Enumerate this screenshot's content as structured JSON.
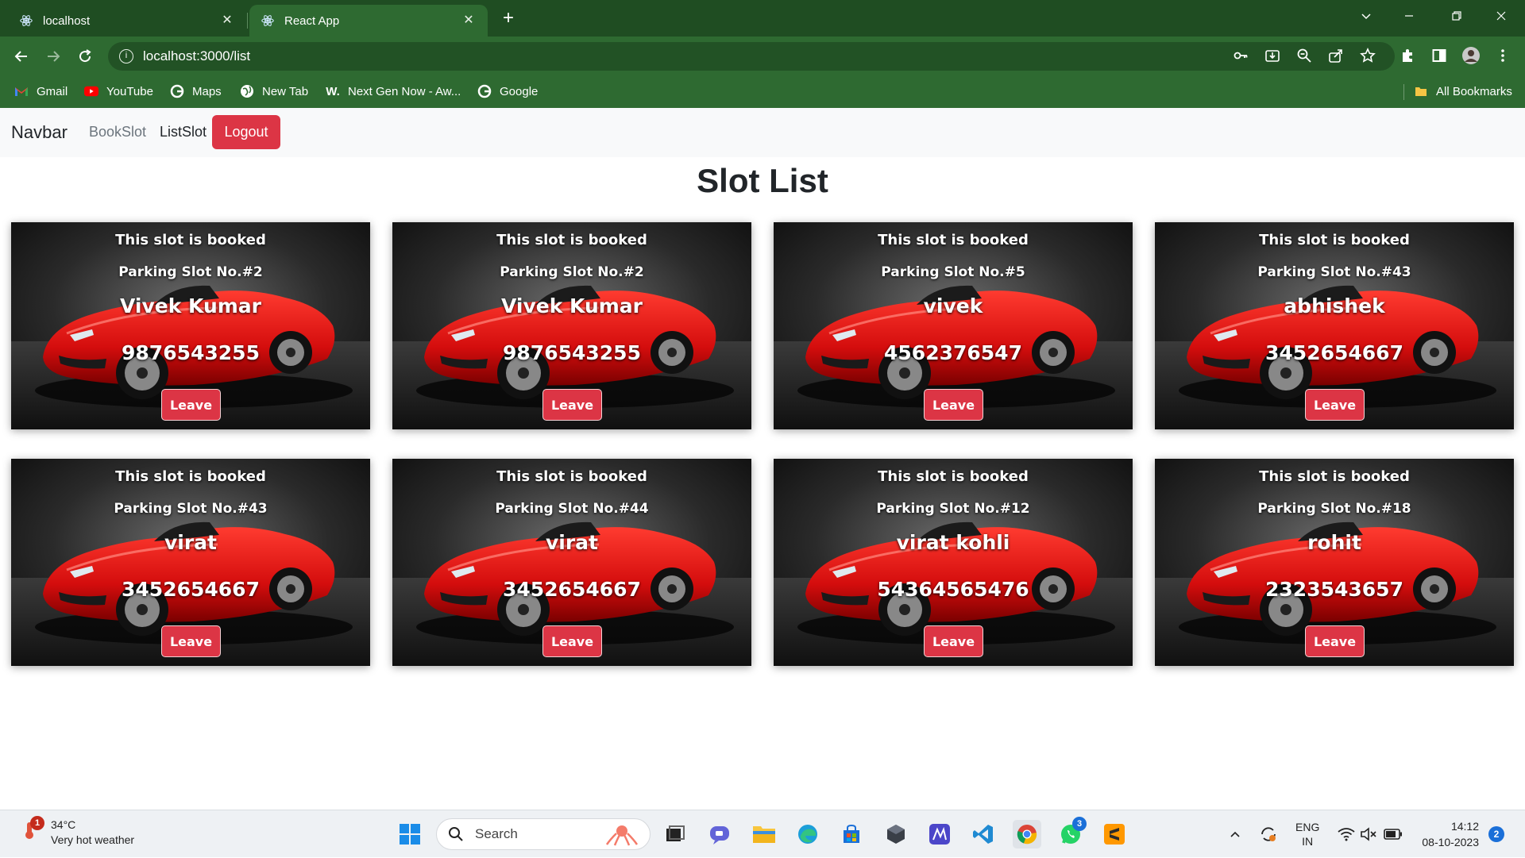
{
  "browser": {
    "tabs": [
      {
        "title": "localhost",
        "active": false
      },
      {
        "title": "React App",
        "active": true
      }
    ],
    "url": "localhost:3000/list",
    "bookmarks": [
      {
        "label": "Gmail",
        "icon": "gmail-icon"
      },
      {
        "label": "YouTube",
        "icon": "youtube-icon"
      },
      {
        "label": "Maps",
        "icon": "google-icon"
      },
      {
        "label": "New Tab",
        "icon": "globe-icon"
      },
      {
        "label": "Next Gen Now - Aw...",
        "icon": "w-icon"
      },
      {
        "label": "Google",
        "icon": "google-icon"
      }
    ],
    "all_bookmarks": "All Bookmarks",
    "colors": {
      "frame": "#1f4d22",
      "toolbar": "#2e6a31"
    }
  },
  "app": {
    "brand": "Navbar",
    "nav": {
      "book_slot": "BookSlot",
      "list_slot": "ListSlot",
      "logout": "Logout"
    },
    "page_title": "Slot List",
    "accent": "#dc3545",
    "cards": [
      {
        "status": "This slot is booked",
        "slot": "Parking Slot No.#2",
        "name": "Vivek Kumar",
        "phone": "9876543255",
        "action": "Leave"
      },
      {
        "status": "This slot is booked",
        "slot": "Parking Slot No.#2",
        "name": "Vivek Kumar",
        "phone": "9876543255",
        "action": "Leave"
      },
      {
        "status": "This slot is booked",
        "slot": "Parking Slot No.#5",
        "name": "vivek",
        "phone": "4562376547",
        "action": "Leave"
      },
      {
        "status": "This slot is booked",
        "slot": "Parking Slot No.#43",
        "name": "abhishek",
        "phone": "3452654667",
        "action": "Leave"
      },
      {
        "status": "This slot is booked",
        "slot": "Parking Slot No.#43",
        "name": "virat",
        "phone": "3452654667",
        "action": "Leave"
      },
      {
        "status": "This slot is booked",
        "slot": "Parking Slot No.#44",
        "name": "virat",
        "phone": "3452654667",
        "action": "Leave"
      },
      {
        "status": "This slot is booked",
        "slot": "Parking Slot No.#12",
        "name": "virat kohli",
        "phone": "54364565476",
        "action": "Leave"
      },
      {
        "status": "This slot is booked",
        "slot": "Parking Slot No.#18",
        "name": "rohit",
        "phone": "2323543657",
        "action": "Leave"
      }
    ]
  },
  "taskbar": {
    "weather": {
      "temp": "34°C",
      "desc": "Very hot weather",
      "badge": "1"
    },
    "search_placeholder": "Search",
    "whatsapp_badge": "3",
    "lang": {
      "line1": "ENG",
      "line2": "IN"
    },
    "time": "14:12",
    "date": "08-10-2023",
    "notifications": "2"
  }
}
